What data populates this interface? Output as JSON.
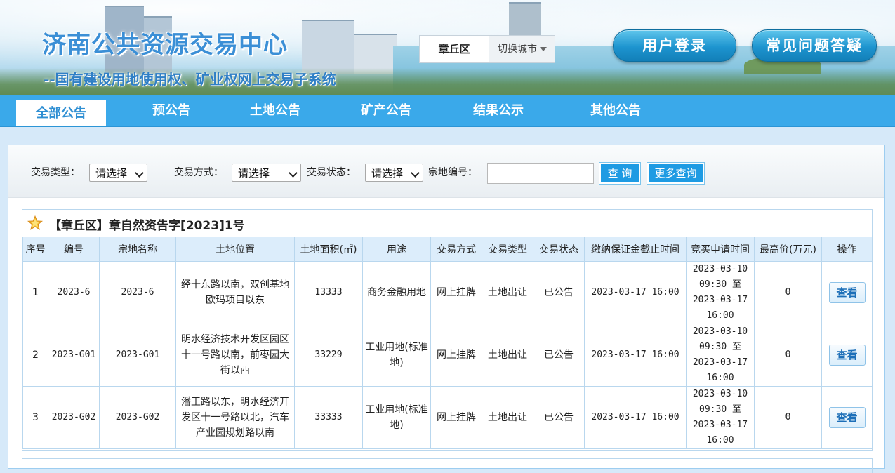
{
  "header": {
    "title": "济南公共资源交易中心",
    "subtitle": "--国有建设用地使用权、矿业权网上交易子系统",
    "city": "章丘区",
    "switch_city": "切换城市",
    "login_button": "用户登录",
    "faq_button": "常见问题答疑"
  },
  "nav": {
    "items": [
      "全部公告",
      "预公告",
      "土地公告",
      "矿产公告",
      "结果公示",
      "其他公告"
    ],
    "active": "全部公告"
  },
  "filters": {
    "trade_type_label": "交易类型：",
    "trade_type_value": "请选择",
    "trade_method_label": "交易方式：",
    "trade_method_value": "请选择",
    "trade_status_label": "交易状态：",
    "trade_status_value": "请选择",
    "parcel_no_label": "宗地编号：",
    "parcel_no_value": "",
    "query_button": "查 询",
    "more_query_button": "更多查询"
  },
  "project": {
    "title": "【章丘区】章自然资告字[2023]1号",
    "columns": [
      "序号",
      "编号",
      "宗地名称",
      "土地位置",
      "土地面积(㎡)",
      "用途",
      "交易方式",
      "交易类型",
      "交易状态",
      "缴纳保证金截止时间",
      "竞买申请时间",
      "最高价(万元)",
      "操作"
    ],
    "rows": [
      {
        "seq": "1",
        "code": "2023-6",
        "name": "2023-6",
        "location": "经十东路以南，双创基地欧玛项目以东",
        "area": "13333",
        "use": "商务金融用地",
        "method": "网上挂牌",
        "type": "土地出让",
        "status": "已公告",
        "deposit_deadline": "2023-03-17 16:00",
        "apply_time": "2023-03-10 09:30 至 2023-03-17 16:00",
        "max_price": "0",
        "action": "查看"
      },
      {
        "seq": "2",
        "code": "2023-G01",
        "name": "2023-G01",
        "location": "明水经济技术开发区园区十一号路以南，前枣园大街以西",
        "area": "33229",
        "use": "工业用地(标准地)",
        "method": "网上挂牌",
        "type": "土地出让",
        "status": "已公告",
        "deposit_deadline": "2023-03-17 16:00",
        "apply_time": "2023-03-10 09:30 至 2023-03-17 16:00",
        "max_price": "0",
        "action": "查看"
      },
      {
        "seq": "3",
        "code": "2023-G02",
        "name": "2023-G02",
        "location": "潘王路以东，明水经济开发区十一号路以北，汽车产业园规划路以南",
        "area": "33333",
        "use": "工业用地(标准地)",
        "method": "网上挂牌",
        "type": "土地出让",
        "status": "已公告",
        "deposit_deadline": "2023-03-17 16:00",
        "apply_time": "2023-03-10 09:30 至 2023-03-17 16:00",
        "max_price": "0",
        "action": "查看"
      }
    ]
  },
  "colors": {
    "nav_bg": "#3aa9ea",
    "header_bg": "#dcedfb",
    "button_blue": "#1e9be3",
    "page_bg": "#d6e9f9"
  }
}
